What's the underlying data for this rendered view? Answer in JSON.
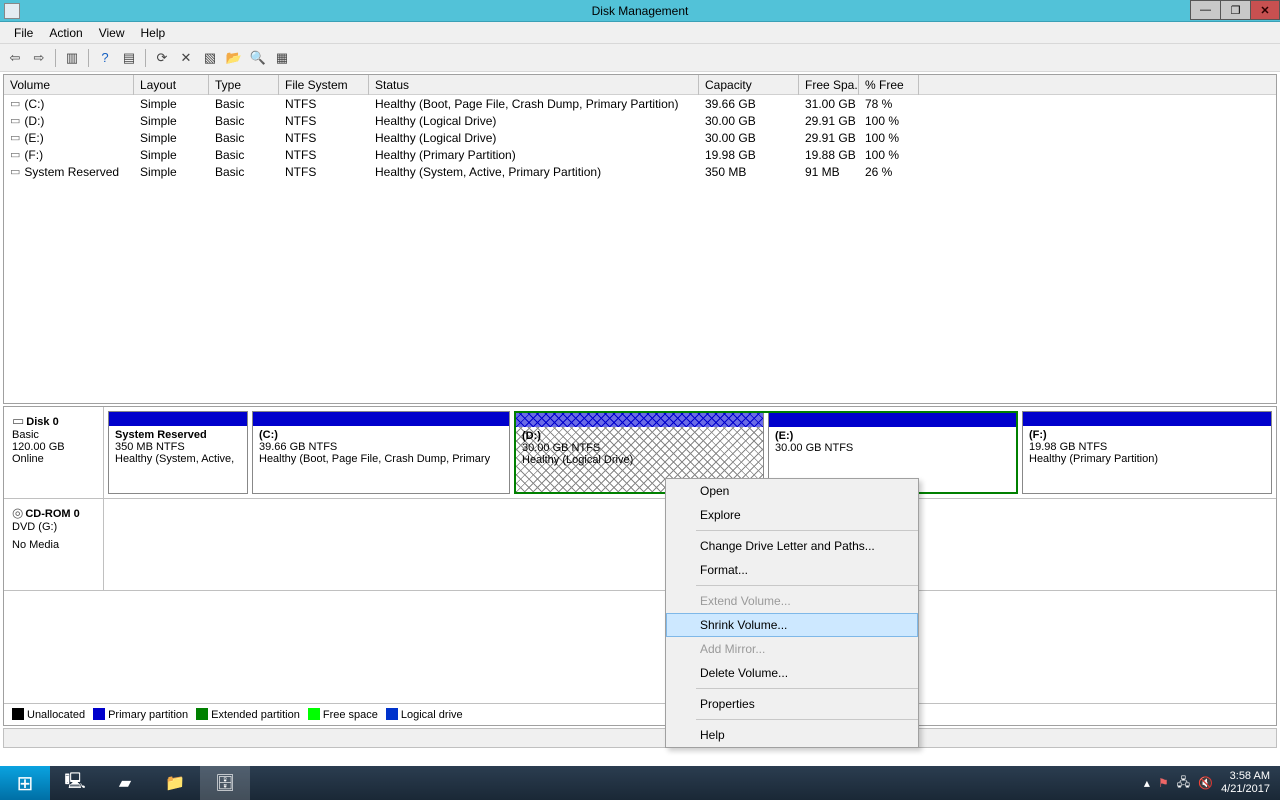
{
  "titlebar": {
    "title": "Disk Management"
  },
  "menu": {
    "file": "File",
    "action": "Action",
    "view": "View",
    "help": "Help"
  },
  "table": {
    "headers": {
      "volume": "Volume",
      "layout": "Layout",
      "type": "Type",
      "fs": "File System",
      "status": "Status",
      "capacity": "Capacity",
      "free": "Free Spa...",
      "pct": "% Free"
    },
    "rows": [
      {
        "vol": "(C:)",
        "layout": "Simple",
        "type": "Basic",
        "fs": "NTFS",
        "status": "Healthy (Boot, Page File, Crash Dump, Primary Partition)",
        "cap": "39.66 GB",
        "free": "31.00 GB",
        "pct": "78 %"
      },
      {
        "vol": "(D:)",
        "layout": "Simple",
        "type": "Basic",
        "fs": "NTFS",
        "status": "Healthy (Logical Drive)",
        "cap": "30.00 GB",
        "free": "29.91 GB",
        "pct": "100 %"
      },
      {
        "vol": "(E:)",
        "layout": "Simple",
        "type": "Basic",
        "fs": "NTFS",
        "status": "Healthy (Logical Drive)",
        "cap": "30.00 GB",
        "free": "29.91 GB",
        "pct": "100 %"
      },
      {
        "vol": "(F:)",
        "layout": "Simple",
        "type": "Basic",
        "fs": "NTFS",
        "status": "Healthy (Primary Partition)",
        "cap": "19.98 GB",
        "free": "19.88 GB",
        "pct": "100 %"
      },
      {
        "vol": "System Reserved",
        "layout": "Simple",
        "type": "Basic",
        "fs": "NTFS",
        "status": "Healthy (System, Active, Primary Partition)",
        "cap": "350 MB",
        "free": "91 MB",
        "pct": "26 %"
      }
    ]
  },
  "disk": {
    "name": "Disk 0",
    "t1": "Basic",
    "t2": "120.00 GB",
    "t3": "Online",
    "parts": {
      "sr": {
        "name": "System Reserved",
        "line2": "350 MB NTFS",
        "line3": "Healthy (System, Active,"
      },
      "c": {
        "name": "(C:)",
        "line2": "39.66 GB NTFS",
        "line3": "Healthy (Boot, Page File, Crash Dump, Primary"
      },
      "d": {
        "name": "(D:)",
        "line2": "30.00 GB NTFS",
        "line3": "Healthy (Logical Drive)"
      },
      "e": {
        "name": "(E:)",
        "line2": "30.00 GB NTFS",
        "line3": ""
      },
      "f": {
        "name": "(F:)",
        "line2": "19.98 GB NTFS",
        "line3": "Healthy (Primary Partition)"
      }
    }
  },
  "cdrom": {
    "name": "CD-ROM 0",
    "line2": "DVD (G:)",
    "line3": "No Media"
  },
  "legend": {
    "unalloc": "Unallocated",
    "primary": "Primary partition",
    "extended": "Extended partition",
    "free": "Free space",
    "logical": "Logical drive"
  },
  "context": {
    "open": "Open",
    "explore": "Explore",
    "cdlp": "Change Drive Letter and Paths...",
    "format": "Format...",
    "extend": "Extend Volume...",
    "shrink": "Shrink Volume...",
    "mirror": "Add Mirror...",
    "delete": "Delete Volume...",
    "properties": "Properties",
    "help": "Help"
  },
  "tray": {
    "time": "3:58 AM",
    "date": "4/21/2017"
  }
}
